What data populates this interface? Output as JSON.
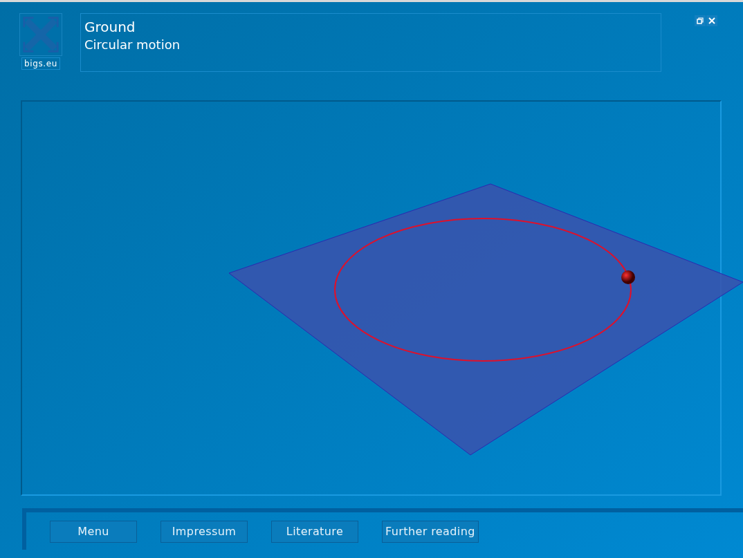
{
  "logo": {
    "caption": "bigs.eu"
  },
  "header": {
    "title": "Ground",
    "subtitle": "Circular motion"
  },
  "buttons": [
    {
      "label": "Menu"
    },
    {
      "label": "Impressum"
    },
    {
      "label": "Literature"
    },
    {
      "label": "Further reading"
    }
  ]
}
